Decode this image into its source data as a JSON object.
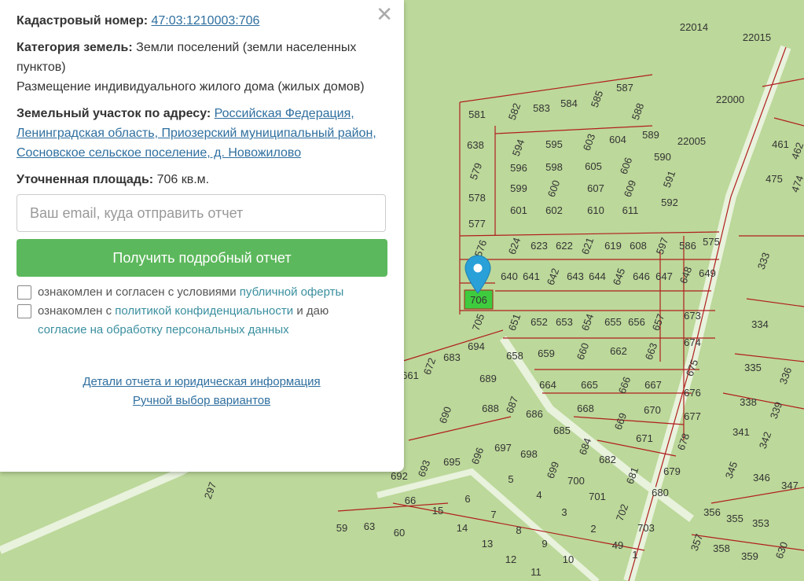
{
  "panel": {
    "cadastral_label": "Кадастровый номер:",
    "cadastral_value": "47:03:1210003:706",
    "category_label": "Категория земель:",
    "category_value": "Земли поселений (земли населенных пунктов)",
    "usage": "Размещение индивидуального жилого дома (жилых домов)",
    "address_label": "Земельный участок по адресу:",
    "address_value": "Российская Федерация, Ленинградская область, Приозерский муниципальный район, Сосновское сельское поселение, д. Новожилово",
    "area_label": "Уточненная площадь:",
    "area_value": "706 кв.м.",
    "email_placeholder": "Ваш email, куда отправить отчет",
    "submit_label": "Получить подробный отчет",
    "check1_text": "ознакомлен и согласен с условиями",
    "check1_link": "публичной оферты",
    "check2_text_a": "ознакомлен с",
    "check2_link1": "политикой конфиденциальности",
    "check2_text_b": "и даю",
    "check2_link2": "согласие на обработку персональных данных",
    "footer_link1": "Детали отчета и юридическая информация",
    "footer_link2": "Ручной выбор вариантов",
    "close_icon": "close-icon"
  },
  "map": {
    "selected_plot": "706",
    "colors": {
      "background": "#bcd89a",
      "lines": "#b01e1e",
      "selected": "#3ecb3e",
      "pin": "#2aa0d8"
    },
    "plots": [
      "22014",
      "22015",
      "22000",
      "22005",
      "581",
      "582",
      "583",
      "584",
      "585",
      "587",
      "588",
      "589",
      "590",
      "638",
      "594",
      "595",
      "603",
      "604",
      "579",
      "596",
      "598",
      "605",
      "606",
      "578",
      "599",
      "600",
      "607",
      "609",
      "591",
      "577",
      "601",
      "602",
      "610",
      "611",
      "592",
      "576",
      "624",
      "623",
      "622",
      "621",
      "619",
      "608",
      "597",
      "586",
      "575",
      "640",
      "641",
      "642",
      "643",
      "644",
      "645",
      "646",
      "647",
      "648",
      "649",
      "706",
      "705",
      "651",
      "652",
      "653",
      "654",
      "655",
      "656",
      "657",
      "673",
      "694",
      "683",
      "672",
      "661",
      "658",
      "659",
      "660",
      "662",
      "663",
      "674",
      "675",
      "689",
      "664",
      "665",
      "666",
      "667",
      "676",
      "690",
      "688",
      "687",
      "686",
      "685",
      "668",
      "669",
      "670",
      "677",
      "671",
      "678",
      "684",
      "682",
      "681",
      "679",
      "680",
      "695",
      "693",
      "696",
      "697",
      "698",
      "699",
      "700",
      "701",
      "702",
      "703",
      "692",
      "66",
      "15",
      "6",
      "7",
      "5",
      "4",
      "3",
      "2",
      "59",
      "63",
      "60",
      "14",
      "8",
      "13",
      "9",
      "10",
      "12",
      "11",
      "49",
      "1",
      "297",
      "333",
      "334",
      "335",
      "336",
      "338",
      "339",
      "341",
      "342",
      "345",
      "346",
      "347",
      "356",
      "355",
      "353",
      "357",
      "358",
      "359",
      "630",
      "461",
      "462",
      "475",
      "474"
    ]
  }
}
